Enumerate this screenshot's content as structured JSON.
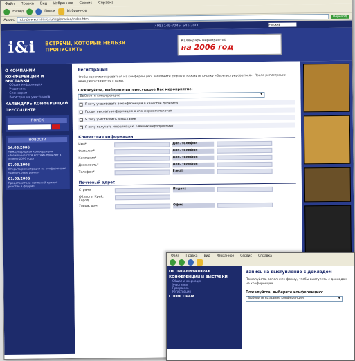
{
  "browser": {
    "menu": [
      "Файл",
      "Правка",
      "Вид",
      "Избранное",
      "Сервис",
      "Справка"
    ],
    "toolbar": {
      "back": "Назад",
      "search": "Поиск",
      "favorites": "Избранное"
    },
    "address_label": "Адрес",
    "address": "http://www.imi-info.ru/registration/index.html",
    "go": "Переход"
  },
  "site": {
    "phones": "(495) 149-7046, 641-2000",
    "language": "Русский",
    "logo": "i&i",
    "slogan": "ВСТРЕЧИ, КОТОРЫЕ НЕЛЬЗЯ ПРОПУСТИТЬ",
    "banner_text": "Календарь мероприятий",
    "banner_year": "на 2006 год"
  },
  "nav": [
    {
      "head": "О КОМПАНИИ",
      "items": []
    },
    {
      "head": "КОНФЕРЕНЦИИ И ВЫСТАВКИ",
      "items": [
        "Общая информация",
        "Участники",
        "Спонсорам",
        "Регистрация участников"
      ]
    },
    {
      "head": "КАЛЕНДАРЬ КОНФЕРЕНЦИЙ",
      "items": []
    },
    {
      "head": "ПРЕСС-ЦЕНТР",
      "items": []
    }
  ],
  "search": {
    "title": "ПОИСК",
    "placeholder": ""
  },
  "news": {
    "title": "НОВОСТИ",
    "items": [
      {
        "date": "14.03.2006",
        "text": "Международная конференция «Розничные сети России» пройдет в апреле 2006 года"
      },
      {
        "date": "07.03.2006",
        "text": "Открыта регистрация на конференцию «Финансовые рынки»"
      },
      {
        "date": "01.03.2006",
        "text": "Представители компаний примут участие в форуме"
      }
    ]
  },
  "form": {
    "title": "Регистрация",
    "intro": "Чтобы зарегистрироваться на конференцию, заполните форму и нажмите кнопку «Зарегистрироваться». После регистрации менеджер свяжется с вами.",
    "conf_label": "Пожалуйста, выберите интересующее Вас мероприятие:",
    "conf_value": "Выберите конференцию",
    "options": [
      "Я хочу участвовать в конференции в качестве делегата",
      "Прошу выслать информацию о спонсорских пакетах",
      "Я хочу участвовать в выставке",
      "Я хочу получать информацию о ваших мероприятиях"
    ],
    "contact_title": "Контактная информация",
    "fields": [
      {
        "l": "Имя*",
        "r": "Доп. телефон"
      },
      {
        "l": "Фамилия*",
        "r": "Доп. телефон"
      },
      {
        "l": "Компания*",
        "r": "Доп. телефон"
      },
      {
        "l": "Должность*",
        "r": "Доп. телефон"
      },
      {
        "l": "Телефон*",
        "r": "E-mail"
      }
    ],
    "addr_title": "Почтовый адрес",
    "addr_fields": [
      {
        "l": "Страна",
        "r": "Индекс"
      },
      {
        "l": "Область, Край, Город",
        "r": ""
      },
      {
        "l": "Улица, дом",
        "r": "Офис"
      }
    ]
  },
  "popup": {
    "menu": [
      "Файл",
      "Правка",
      "Вид",
      "Избранное",
      "Сервис",
      "Справка"
    ],
    "nav": [
      {
        "head": "ОБ ОРГАНИЗАТОРАХ",
        "items": []
      },
      {
        "head": "КОНФЕРЕНЦИИ И ВЫСТАВКИ",
        "items": [
          "Общая информация",
          "Участники",
          "Программа",
          "Регистрация"
        ]
      },
      {
        "head": "СПОНСОРАМ",
        "items": []
      }
    ],
    "title": "Запись на выступление с докладом",
    "text": "Пожалуйста, заполните форму, чтобы выступить с докладом на конференции.",
    "select_label": "Пожалуйста, выберите конференцию:",
    "select_value": "Выберите название конференции"
  }
}
